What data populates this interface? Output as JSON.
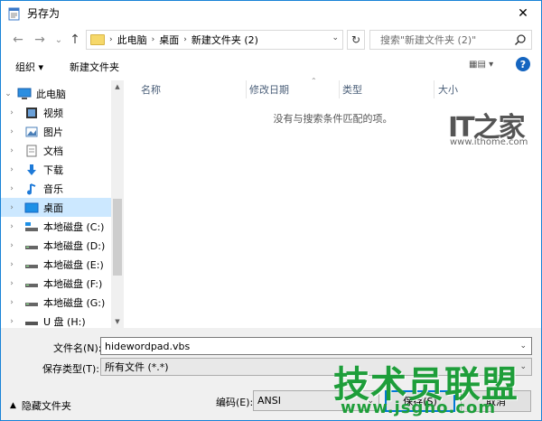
{
  "window": {
    "title": "另存为",
    "close": "✕"
  },
  "nav": {
    "back": "←",
    "forward": "→",
    "recent": "⌄",
    "up": "↑",
    "breadcrumbs": [
      "此电脑",
      "桌面",
      "新建文件夹 (2)"
    ],
    "address_dropdown": "⌄",
    "refresh": "↻",
    "search_placeholder": "搜索\"新建文件夹 (2)\""
  },
  "toolbar": {
    "organize": "组织 ▾",
    "new_folder": "新建文件夹",
    "view": "▦▤ ▾",
    "help": "?"
  },
  "tree": [
    {
      "label": "此电脑",
      "icon": "computer-icon",
      "chevron": "⌄",
      "selected": false
    },
    {
      "label": "视频",
      "icon": "video-icon",
      "chevron": "›",
      "selected": false
    },
    {
      "label": "图片",
      "icon": "picture-icon",
      "chevron": "›",
      "selected": false
    },
    {
      "label": "文档",
      "icon": "document-icon",
      "chevron": "›",
      "selected": false
    },
    {
      "label": "下载",
      "icon": "download-icon",
      "chevron": "›",
      "selected": false
    },
    {
      "label": "音乐",
      "icon": "music-icon",
      "chevron": "›",
      "selected": false
    },
    {
      "label": "桌面",
      "icon": "desktop-icon",
      "chevron": "›",
      "selected": true
    },
    {
      "label": "本地磁盘 (C:)",
      "icon": "drive-c-icon",
      "chevron": "›",
      "selected": false
    },
    {
      "label": "本地磁盘 (D:)",
      "icon": "drive-icon",
      "chevron": "›",
      "selected": false
    },
    {
      "label": "本地磁盘 (E:)",
      "icon": "drive-icon",
      "chevron": "›",
      "selected": false
    },
    {
      "label": "本地磁盘 (F:)",
      "icon": "drive-icon",
      "chevron": "›",
      "selected": false
    },
    {
      "label": "本地磁盘 (G:)",
      "icon": "drive-icon",
      "chevron": "›",
      "selected": false
    },
    {
      "label": "U 盘 (H:)",
      "icon": "usb-drive-icon",
      "chevron": "›",
      "selected": false
    }
  ],
  "columns": [
    "名称",
    "修改日期",
    "类型",
    "大小"
  ],
  "empty_message": "没有与搜索条件匹配的项。",
  "watermark": {
    "brand": "IT之家",
    "url": "www.ithome.com"
  },
  "form": {
    "filename_label": "文件名(N):",
    "filename_value": "hidewordpad.vbs",
    "filetype_label": "保存类型(T):",
    "filetype_value": "所有文件 (*.*)",
    "encoding_label": "编码(E):",
    "encoding_value": "ANSI",
    "hide_folders": "隐藏文件夹",
    "save": "保存(S)",
    "cancel": "取消"
  },
  "watermark2": {
    "brand": "技术员联盟",
    "url": "www.jsgho.com"
  },
  "colors": {
    "selection": "#cce8ff",
    "accent": "#0078d7",
    "border": "#1883d7"
  }
}
